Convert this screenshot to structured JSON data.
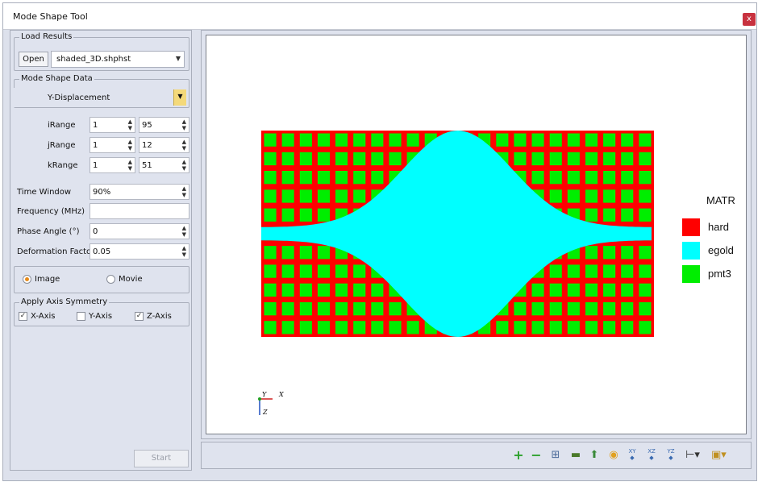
{
  "window": {
    "title": "Mode Shape Tool",
    "close_label": "x"
  },
  "load_results": {
    "legend": "Load Results",
    "open_label": "Open",
    "file": "shaded_3D.shphst"
  },
  "mode_shape": {
    "legend": "Mode Shape Data",
    "selected": "Y-Displacement"
  },
  "ranges": [
    {
      "label": "iRange",
      "min": "1",
      "max": "95"
    },
    {
      "label": "jRange",
      "min": "1",
      "max": "12"
    },
    {
      "label": "kRange",
      "min": "1",
      "max": "51"
    }
  ],
  "params": {
    "time_window_label": "Time Window",
    "time_window": "90%",
    "frequency_label": "Frequency (MHz)",
    "frequency": "",
    "phase_label": "Phase Angle (°)",
    "phase": "0",
    "deformation_label": "Deformation Factor",
    "deformation": "0.05"
  },
  "output": {
    "image_label": "Image",
    "movie_label": "Movie",
    "selected": "Image"
  },
  "symmetry": {
    "legend": "Apply Axis Symmetry",
    "x_label": "X-Axis",
    "x_checked": true,
    "y_label": "Y-Axis",
    "y_checked": false,
    "z_label": "Z-Axis",
    "z_checked": true
  },
  "start_label": "Start",
  "legend": {
    "title": "MATR",
    "items": [
      {
        "name": "hard",
        "color": "#ff0000"
      },
      {
        "name": "egold",
        "color": "#00ffff"
      },
      {
        "name": "pmt3",
        "color": "#00ee00"
      }
    ]
  },
  "axes_triad": {
    "y": "Y",
    "x": "X",
    "z": "Z"
  },
  "toolbar_icons": [
    "zoom-in-icon",
    "zoom-out-icon",
    "fit-view-icon",
    "pan-icon",
    "rotate-icon",
    "center-icon",
    "view-xy-icon",
    "view-xz-icon",
    "view-yz-icon",
    "measure-icon",
    "export-icon"
  ],
  "toolbar_labels": {
    "xy": "XY",
    "xz": "XZ",
    "yz": "YZ"
  },
  "colors": {
    "hard": "#ff0000",
    "egold": "#00ffff",
    "pmt3": "#00ee00",
    "accent": "#e68a1a"
  }
}
